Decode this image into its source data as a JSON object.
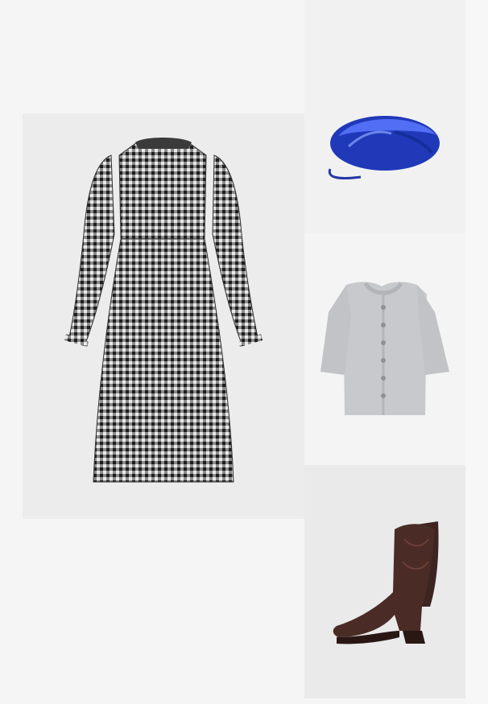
{
  "outfit": {
    "background_color": "#f5f5f5",
    "items": [
      {
        "slot": "dress",
        "icon": "gingham-smocked-midi-dress-image",
        "colors": [
          "#2b2b2b",
          "#e6e6e6"
        ]
      },
      {
        "slot": "bag",
        "icon": "metallic-blue-pouch-bag-image",
        "colors": [
          "#1f39b8",
          "#6f8bff"
        ]
      },
      {
        "slot": "top",
        "icon": "grey-knit-short-sleeve-cardigan-image",
        "colors": [
          "#b9bcc2",
          "#d6d8dc"
        ]
      },
      {
        "slot": "shoes",
        "icon": "brown-western-boots-image",
        "colors": [
          "#4a2b25",
          "#2a1713"
        ]
      }
    ]
  }
}
